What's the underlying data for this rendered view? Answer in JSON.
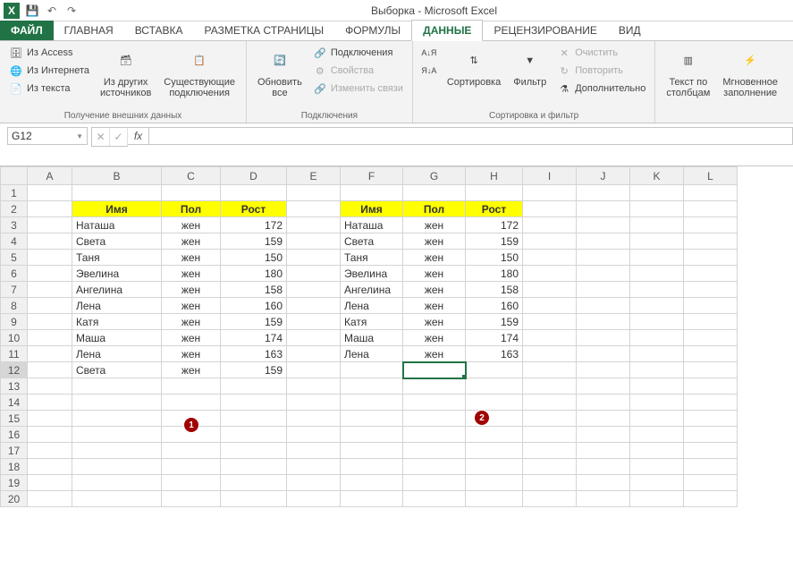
{
  "app_title": "Выборка - Microsoft Excel",
  "qat": {
    "excel_icon": "X",
    "save": "💾",
    "undo": "↶",
    "redo": "↷"
  },
  "tabs": {
    "file": "ФАЙЛ",
    "items": [
      "ГЛАВНАЯ",
      "ВСТАВКА",
      "РАЗМЕТКА СТРАНИЦЫ",
      "ФОРМУЛЫ",
      "ДАННЫЕ",
      "РЕЦЕНЗИРОВАНИЕ",
      "ВИД"
    ],
    "active": "ДАННЫЕ"
  },
  "ribbon": {
    "ext_data": {
      "from_access": "Из Access",
      "from_web": "Из Интернета",
      "from_text": "Из текста",
      "other": "Из других\nисточников",
      "existing": "Существующие\nподключения",
      "label": "Получение внешних данных"
    },
    "connections": {
      "refresh": "Обновить\nвсе",
      "conns": "Подключения",
      "props": "Свойства",
      "edit_links": "Изменить связи",
      "label": "Подключения"
    },
    "sort_filter": {
      "sort_az": "A↓Я",
      "sort_za": "Я↓А",
      "sort": "Сортировка",
      "filter": "Фильтр",
      "clear": "Очистить",
      "reapply": "Повторить",
      "advanced": "Дополнительно",
      "label": "Сортировка и фильтр"
    },
    "tools": {
      "text_to_cols": "Текст по\nстолбцам",
      "flash_fill": "Мгновенное\nзаполнение"
    }
  },
  "namebox": "G12",
  "columns": [
    "A",
    "B",
    "C",
    "D",
    "E",
    "F",
    "G",
    "H",
    "I",
    "J",
    "K",
    "L"
  ],
  "rowCount": 20,
  "selected": {
    "row": 12,
    "col": "G"
  },
  "headers": {
    "name": "Имя",
    "sex": "Пол",
    "height": "Рост"
  },
  "table1": [
    [
      "Наташа",
      "жен",
      172
    ],
    [
      "Света",
      "жен",
      159
    ],
    [
      "Таня",
      "жен",
      150
    ],
    [
      "Эвелина",
      "жен",
      180
    ],
    [
      "Ангелина",
      "жен",
      158
    ],
    [
      "Лена",
      "жен",
      160
    ],
    [
      "Катя",
      "жен",
      159
    ],
    [
      "Маша",
      "жен",
      174
    ],
    [
      "Лена",
      "жен",
      163
    ],
    [
      "Света",
      "жен",
      159
    ]
  ],
  "table2": [
    [
      "Наташа",
      "жен",
      172
    ],
    [
      "Света",
      "жен",
      159
    ],
    [
      "Таня",
      "жен",
      150
    ],
    [
      "Эвелина",
      "жен",
      180
    ],
    [
      "Ангелина",
      "жен",
      158
    ],
    [
      "Лена",
      "жен",
      160
    ],
    [
      "Катя",
      "жен",
      159
    ],
    [
      "Маша",
      "жен",
      174
    ],
    [
      "Лена",
      "жен",
      163
    ]
  ],
  "badges": {
    "b1": "1",
    "b2": "2"
  }
}
